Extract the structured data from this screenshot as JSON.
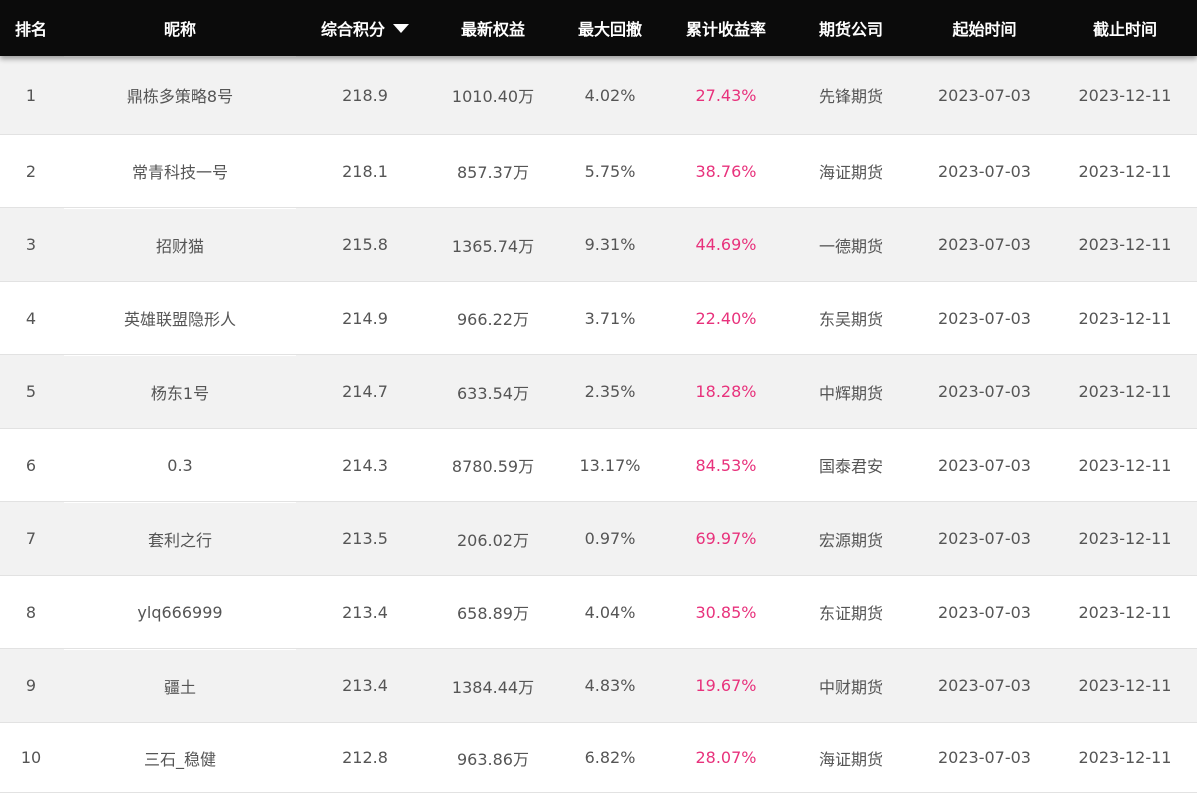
{
  "colors": {
    "header_bg": "#0b0b0b",
    "header_text": "#ffffff",
    "row_odd": "#f2f2f2",
    "row_even": "#ffffff",
    "text": "#555555",
    "return_accent": "#e8327c"
  },
  "table": {
    "columns": [
      {
        "key": "rank",
        "label": "排名"
      },
      {
        "key": "nickname",
        "label": "昵称"
      },
      {
        "key": "score",
        "label": "综合积分",
        "sort_icon": "caret-down-icon",
        "sorted": "desc"
      },
      {
        "key": "equity",
        "label": "最新权益"
      },
      {
        "key": "max_drawdown",
        "label": "最大回撤"
      },
      {
        "key": "cumulative_return",
        "label": "累计收益率"
      },
      {
        "key": "company",
        "label": "期货公司"
      },
      {
        "key": "start",
        "label": "起始时间"
      },
      {
        "key": "end",
        "label": "截止时间"
      }
    ],
    "rows": [
      {
        "rank": "1",
        "nickname": "鼎栋多策略8号",
        "score": "218.9",
        "equity": "1010.40万",
        "max_drawdown": "4.02%",
        "cumulative_return": "27.43%",
        "company": "先锋期货",
        "start": "2023-07-03",
        "end": "2023-12-11"
      },
      {
        "rank": "2",
        "nickname": "常青科技一号",
        "score": "218.1",
        "equity": "857.37万",
        "max_drawdown": "5.75%",
        "cumulative_return": "38.76%",
        "company": "海证期货",
        "start": "2023-07-03",
        "end": "2023-12-11"
      },
      {
        "rank": "3",
        "nickname": "招财猫",
        "score": "215.8",
        "equity": "1365.74万",
        "max_drawdown": "9.31%",
        "cumulative_return": "44.69%",
        "company": "一德期货",
        "start": "2023-07-03",
        "end": "2023-12-11"
      },
      {
        "rank": "4",
        "nickname": "英雄联盟隐形人",
        "score": "214.9",
        "equity": "966.22万",
        "max_drawdown": "3.71%",
        "cumulative_return": "22.40%",
        "company": "东吴期货",
        "start": "2023-07-03",
        "end": "2023-12-11"
      },
      {
        "rank": "5",
        "nickname": "杨东1号",
        "score": "214.7",
        "equity": "633.54万",
        "max_drawdown": "2.35%",
        "cumulative_return": "18.28%",
        "company": "中辉期货",
        "start": "2023-07-03",
        "end": "2023-12-11"
      },
      {
        "rank": "6",
        "nickname": "0.3",
        "score": "214.3",
        "equity": "8780.59万",
        "max_drawdown": "13.17%",
        "cumulative_return": "84.53%",
        "company": "国泰君安",
        "start": "2023-07-03",
        "end": "2023-12-11"
      },
      {
        "rank": "7",
        "nickname": "套利之行",
        "score": "213.5",
        "equity": "206.02万",
        "max_drawdown": "0.97%",
        "cumulative_return": "69.97%",
        "company": "宏源期货",
        "start": "2023-07-03",
        "end": "2023-12-11"
      },
      {
        "rank": "8",
        "nickname": "ylq666999",
        "score": "213.4",
        "equity": "658.89万",
        "max_drawdown": "4.04%",
        "cumulative_return": "30.85%",
        "company": "东证期货",
        "start": "2023-07-03",
        "end": "2023-12-11"
      },
      {
        "rank": "9",
        "nickname": "疆土",
        "score": "213.4",
        "equity": "1384.44万",
        "max_drawdown": "4.83%",
        "cumulative_return": "19.67%",
        "company": "中财期货",
        "start": "2023-07-03",
        "end": "2023-12-11"
      },
      {
        "rank": "10",
        "nickname": "三石_稳健",
        "score": "212.8",
        "equity": "963.86万",
        "max_drawdown": "6.82%",
        "cumulative_return": "28.07%",
        "company": "海证期货",
        "start": "2023-07-03",
        "end": "2023-12-11"
      }
    ]
  }
}
